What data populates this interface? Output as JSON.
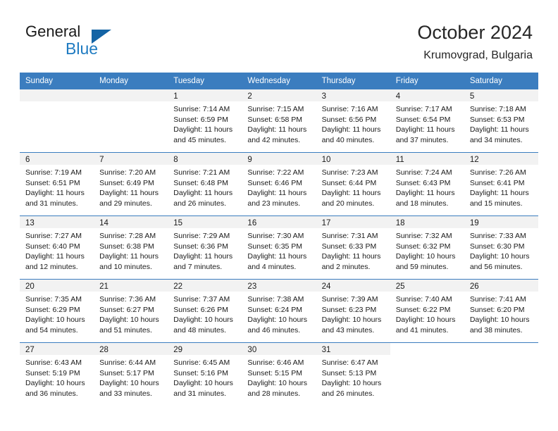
{
  "brand": {
    "name_part1": "General",
    "name_part2": "Blue",
    "triangle_icon": "triangle-icon",
    "accent_color": "#1f7bc1",
    "header_color": "#3b7dbf"
  },
  "header": {
    "title": "October 2024",
    "subtitle": "Krumovgrad, Bulgaria"
  },
  "calendar": {
    "weekday_headers": [
      "Sunday",
      "Monday",
      "Tuesday",
      "Wednesday",
      "Thursday",
      "Friday",
      "Saturday"
    ],
    "weeks": [
      [
        {
          "day": "",
          "lines": []
        },
        {
          "day": "",
          "lines": []
        },
        {
          "day": "1",
          "lines": [
            "Sunrise: 7:14 AM",
            "Sunset: 6:59 PM",
            "Daylight: 11 hours",
            "and 45 minutes."
          ]
        },
        {
          "day": "2",
          "lines": [
            "Sunrise: 7:15 AM",
            "Sunset: 6:58 PM",
            "Daylight: 11 hours",
            "and 42 minutes."
          ]
        },
        {
          "day": "3",
          "lines": [
            "Sunrise: 7:16 AM",
            "Sunset: 6:56 PM",
            "Daylight: 11 hours",
            "and 40 minutes."
          ]
        },
        {
          "day": "4",
          "lines": [
            "Sunrise: 7:17 AM",
            "Sunset: 6:54 PM",
            "Daylight: 11 hours",
            "and 37 minutes."
          ]
        },
        {
          "day": "5",
          "lines": [
            "Sunrise: 7:18 AM",
            "Sunset: 6:53 PM",
            "Daylight: 11 hours",
            "and 34 minutes."
          ]
        }
      ],
      [
        {
          "day": "6",
          "lines": [
            "Sunrise: 7:19 AM",
            "Sunset: 6:51 PM",
            "Daylight: 11 hours",
            "and 31 minutes."
          ]
        },
        {
          "day": "7",
          "lines": [
            "Sunrise: 7:20 AM",
            "Sunset: 6:49 PM",
            "Daylight: 11 hours",
            "and 29 minutes."
          ]
        },
        {
          "day": "8",
          "lines": [
            "Sunrise: 7:21 AM",
            "Sunset: 6:48 PM",
            "Daylight: 11 hours",
            "and 26 minutes."
          ]
        },
        {
          "day": "9",
          "lines": [
            "Sunrise: 7:22 AM",
            "Sunset: 6:46 PM",
            "Daylight: 11 hours",
            "and 23 minutes."
          ]
        },
        {
          "day": "10",
          "lines": [
            "Sunrise: 7:23 AM",
            "Sunset: 6:44 PM",
            "Daylight: 11 hours",
            "and 20 minutes."
          ]
        },
        {
          "day": "11",
          "lines": [
            "Sunrise: 7:24 AM",
            "Sunset: 6:43 PM",
            "Daylight: 11 hours",
            "and 18 minutes."
          ]
        },
        {
          "day": "12",
          "lines": [
            "Sunrise: 7:26 AM",
            "Sunset: 6:41 PM",
            "Daylight: 11 hours",
            "and 15 minutes."
          ]
        }
      ],
      [
        {
          "day": "13",
          "lines": [
            "Sunrise: 7:27 AM",
            "Sunset: 6:40 PM",
            "Daylight: 11 hours",
            "and 12 minutes."
          ]
        },
        {
          "day": "14",
          "lines": [
            "Sunrise: 7:28 AM",
            "Sunset: 6:38 PM",
            "Daylight: 11 hours",
            "and 10 minutes."
          ]
        },
        {
          "day": "15",
          "lines": [
            "Sunrise: 7:29 AM",
            "Sunset: 6:36 PM",
            "Daylight: 11 hours",
            "and 7 minutes."
          ]
        },
        {
          "day": "16",
          "lines": [
            "Sunrise: 7:30 AM",
            "Sunset: 6:35 PM",
            "Daylight: 11 hours",
            "and 4 minutes."
          ]
        },
        {
          "day": "17",
          "lines": [
            "Sunrise: 7:31 AM",
            "Sunset: 6:33 PM",
            "Daylight: 11 hours",
            "and 2 minutes."
          ]
        },
        {
          "day": "18",
          "lines": [
            "Sunrise: 7:32 AM",
            "Sunset: 6:32 PM",
            "Daylight: 10 hours",
            "and 59 minutes."
          ]
        },
        {
          "day": "19",
          "lines": [
            "Sunrise: 7:33 AM",
            "Sunset: 6:30 PM",
            "Daylight: 10 hours",
            "and 56 minutes."
          ]
        }
      ],
      [
        {
          "day": "20",
          "lines": [
            "Sunrise: 7:35 AM",
            "Sunset: 6:29 PM",
            "Daylight: 10 hours",
            "and 54 minutes."
          ]
        },
        {
          "day": "21",
          "lines": [
            "Sunrise: 7:36 AM",
            "Sunset: 6:27 PM",
            "Daylight: 10 hours",
            "and 51 minutes."
          ]
        },
        {
          "day": "22",
          "lines": [
            "Sunrise: 7:37 AM",
            "Sunset: 6:26 PM",
            "Daylight: 10 hours",
            "and 48 minutes."
          ]
        },
        {
          "day": "23",
          "lines": [
            "Sunrise: 7:38 AM",
            "Sunset: 6:24 PM",
            "Daylight: 10 hours",
            "and 46 minutes."
          ]
        },
        {
          "day": "24",
          "lines": [
            "Sunrise: 7:39 AM",
            "Sunset: 6:23 PM",
            "Daylight: 10 hours",
            "and 43 minutes."
          ]
        },
        {
          "day": "25",
          "lines": [
            "Sunrise: 7:40 AM",
            "Sunset: 6:22 PM",
            "Daylight: 10 hours",
            "and 41 minutes."
          ]
        },
        {
          "day": "26",
          "lines": [
            "Sunrise: 7:41 AM",
            "Sunset: 6:20 PM",
            "Daylight: 10 hours",
            "and 38 minutes."
          ]
        }
      ],
      [
        {
          "day": "27",
          "lines": [
            "Sunrise: 6:43 AM",
            "Sunset: 5:19 PM",
            "Daylight: 10 hours",
            "and 36 minutes."
          ]
        },
        {
          "day": "28",
          "lines": [
            "Sunrise: 6:44 AM",
            "Sunset: 5:17 PM",
            "Daylight: 10 hours",
            "and 33 minutes."
          ]
        },
        {
          "day": "29",
          "lines": [
            "Sunrise: 6:45 AM",
            "Sunset: 5:16 PM",
            "Daylight: 10 hours",
            "and 31 minutes."
          ]
        },
        {
          "day": "30",
          "lines": [
            "Sunrise: 6:46 AM",
            "Sunset: 5:15 PM",
            "Daylight: 10 hours",
            "and 28 minutes."
          ]
        },
        {
          "day": "31",
          "lines": [
            "Sunrise: 6:47 AM",
            "Sunset: 5:13 PM",
            "Daylight: 10 hours",
            "and 26 minutes."
          ]
        },
        {
          "day": "",
          "lines": []
        },
        {
          "day": "",
          "lines": []
        }
      ]
    ]
  }
}
